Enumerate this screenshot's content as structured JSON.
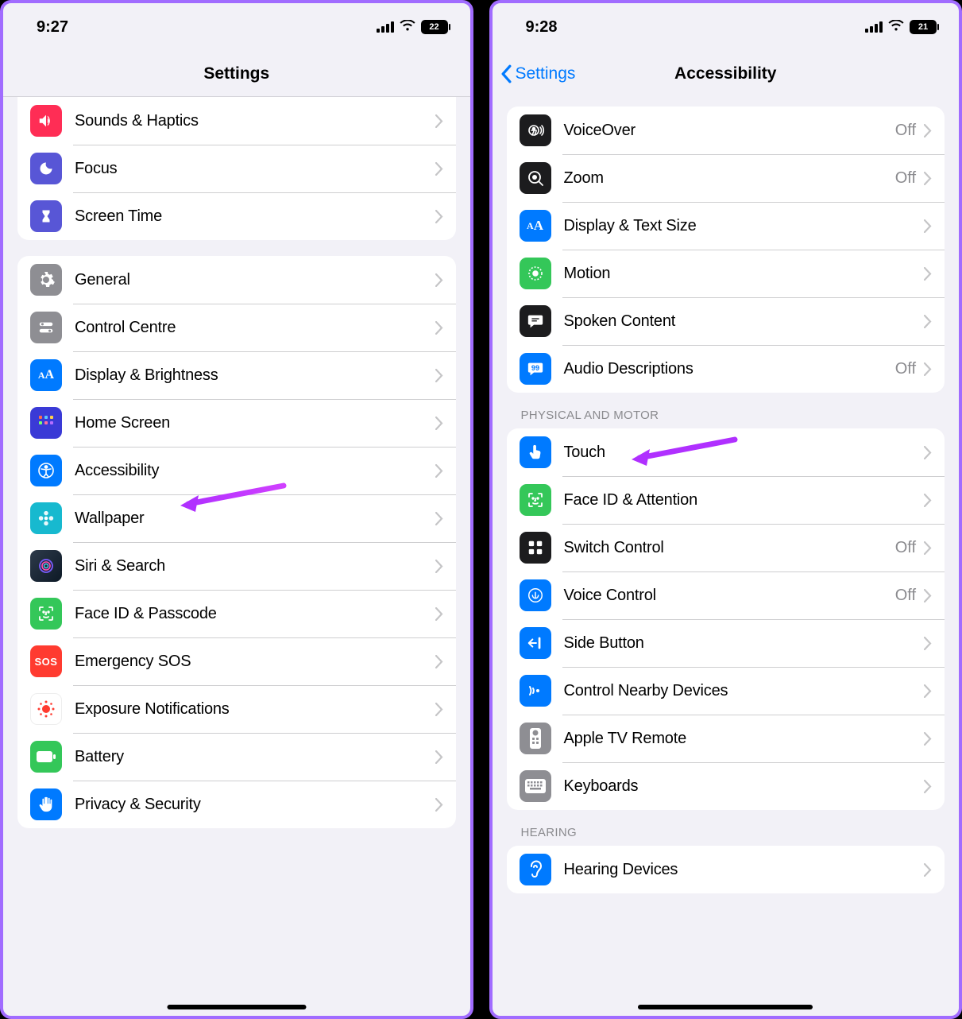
{
  "left": {
    "status": {
      "time": "9:27",
      "battery": "22"
    },
    "title": "Settings",
    "group1": [
      {
        "label": "Sounds & Haptics"
      },
      {
        "label": "Focus"
      },
      {
        "label": "Screen Time"
      }
    ],
    "group2": [
      {
        "label": "General"
      },
      {
        "label": "Control Centre"
      },
      {
        "label": "Display & Brightness"
      },
      {
        "label": "Home Screen"
      },
      {
        "label": "Accessibility"
      },
      {
        "label": "Wallpaper"
      },
      {
        "label": "Siri & Search"
      },
      {
        "label": "Face ID & Passcode"
      },
      {
        "label": "Emergency SOS"
      },
      {
        "label": "Exposure Notifications"
      },
      {
        "label": "Battery"
      },
      {
        "label": "Privacy & Security"
      }
    ]
  },
  "right": {
    "status": {
      "time": "9:28",
      "battery": "21"
    },
    "back": "Settings",
    "title": "Accessibility",
    "group1": [
      {
        "label": "VoiceOver",
        "value": "Off"
      },
      {
        "label": "Zoom",
        "value": "Off"
      },
      {
        "label": "Display & Text Size"
      },
      {
        "label": "Motion"
      },
      {
        "label": "Spoken Content"
      },
      {
        "label": "Audio Descriptions",
        "value": "Off"
      }
    ],
    "sectionPhysical": "PHYSICAL AND MOTOR",
    "group2": [
      {
        "label": "Touch"
      },
      {
        "label": "Face ID & Attention"
      },
      {
        "label": "Switch Control",
        "value": "Off"
      },
      {
        "label": "Voice Control",
        "value": "Off"
      },
      {
        "label": "Side Button"
      },
      {
        "label": "Control Nearby Devices"
      },
      {
        "label": "Apple TV Remote"
      },
      {
        "label": "Keyboards"
      }
    ],
    "sectionHearing": "HEARING",
    "group3": [
      {
        "label": "Hearing Devices"
      }
    ]
  }
}
